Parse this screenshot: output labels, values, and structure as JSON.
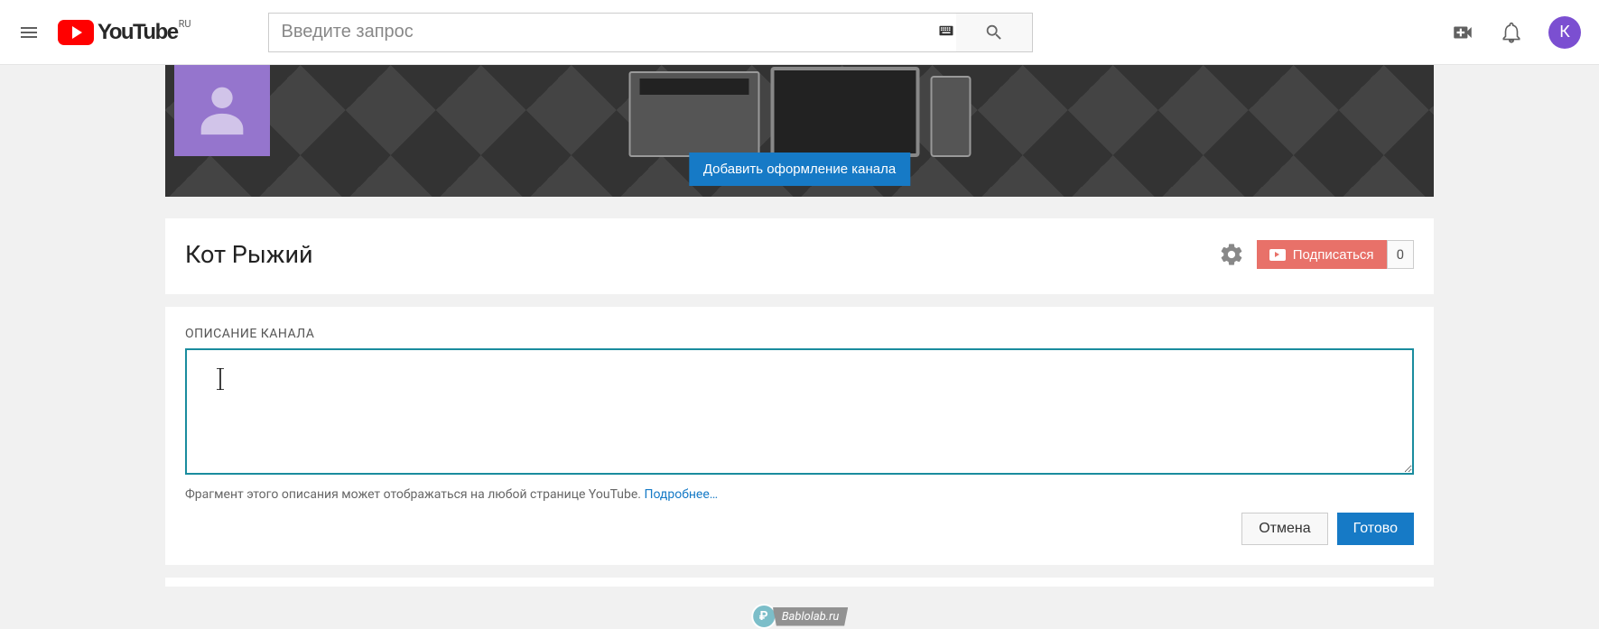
{
  "header": {
    "logo_text": "YouTube",
    "logo_region": "RU",
    "search_placeholder": "Введите запрос",
    "avatar_initial": "К"
  },
  "banner": {
    "add_art_label": "Добавить оформление канала"
  },
  "channel": {
    "name": "Кот Рыжий",
    "subscribe_label": "Подписаться",
    "subscriber_count": "0"
  },
  "description_editor": {
    "label": "ОПИСАНИЕ КАНАЛА",
    "value": "",
    "hint_text": "Фрагмент этого описания может отображаться на любой странице YouTube. ",
    "hint_link": "Подробнее…",
    "cancel_label": "Отмена",
    "done_label": "Готово"
  },
  "watermark": {
    "text": "Bablolab.ru"
  }
}
